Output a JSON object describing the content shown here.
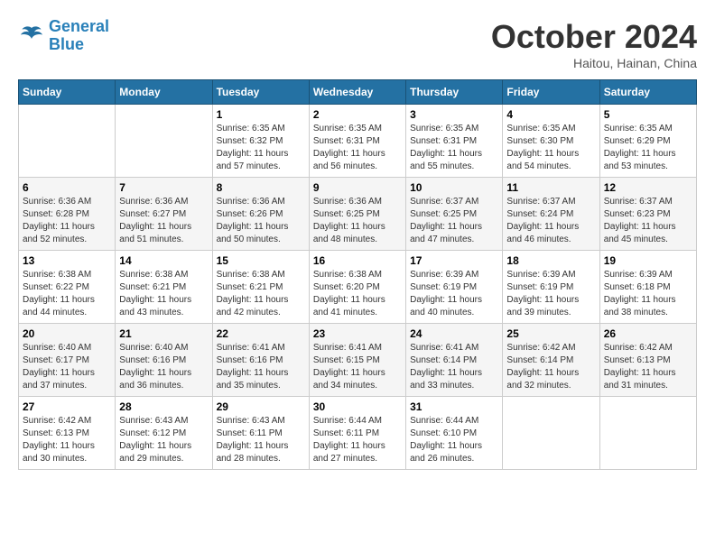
{
  "header": {
    "logo_line1": "General",
    "logo_line2": "Blue",
    "month_title": "October 2024",
    "location": "Haitou, Hainan, China"
  },
  "weekdays": [
    "Sunday",
    "Monday",
    "Tuesday",
    "Wednesday",
    "Thursday",
    "Friday",
    "Saturday"
  ],
  "weeks": [
    [
      {
        "day": "",
        "info": ""
      },
      {
        "day": "",
        "info": ""
      },
      {
        "day": "1",
        "info": "Sunrise: 6:35 AM\nSunset: 6:32 PM\nDaylight: 11 hours and 57 minutes."
      },
      {
        "day": "2",
        "info": "Sunrise: 6:35 AM\nSunset: 6:31 PM\nDaylight: 11 hours and 56 minutes."
      },
      {
        "day": "3",
        "info": "Sunrise: 6:35 AM\nSunset: 6:31 PM\nDaylight: 11 hours and 55 minutes."
      },
      {
        "day": "4",
        "info": "Sunrise: 6:35 AM\nSunset: 6:30 PM\nDaylight: 11 hours and 54 minutes."
      },
      {
        "day": "5",
        "info": "Sunrise: 6:35 AM\nSunset: 6:29 PM\nDaylight: 11 hours and 53 minutes."
      }
    ],
    [
      {
        "day": "6",
        "info": "Sunrise: 6:36 AM\nSunset: 6:28 PM\nDaylight: 11 hours and 52 minutes."
      },
      {
        "day": "7",
        "info": "Sunrise: 6:36 AM\nSunset: 6:27 PM\nDaylight: 11 hours and 51 minutes."
      },
      {
        "day": "8",
        "info": "Sunrise: 6:36 AM\nSunset: 6:26 PM\nDaylight: 11 hours and 50 minutes."
      },
      {
        "day": "9",
        "info": "Sunrise: 6:36 AM\nSunset: 6:25 PM\nDaylight: 11 hours and 48 minutes."
      },
      {
        "day": "10",
        "info": "Sunrise: 6:37 AM\nSunset: 6:25 PM\nDaylight: 11 hours and 47 minutes."
      },
      {
        "day": "11",
        "info": "Sunrise: 6:37 AM\nSunset: 6:24 PM\nDaylight: 11 hours and 46 minutes."
      },
      {
        "day": "12",
        "info": "Sunrise: 6:37 AM\nSunset: 6:23 PM\nDaylight: 11 hours and 45 minutes."
      }
    ],
    [
      {
        "day": "13",
        "info": "Sunrise: 6:38 AM\nSunset: 6:22 PM\nDaylight: 11 hours and 44 minutes."
      },
      {
        "day": "14",
        "info": "Sunrise: 6:38 AM\nSunset: 6:21 PM\nDaylight: 11 hours and 43 minutes."
      },
      {
        "day": "15",
        "info": "Sunrise: 6:38 AM\nSunset: 6:21 PM\nDaylight: 11 hours and 42 minutes."
      },
      {
        "day": "16",
        "info": "Sunrise: 6:38 AM\nSunset: 6:20 PM\nDaylight: 11 hours and 41 minutes."
      },
      {
        "day": "17",
        "info": "Sunrise: 6:39 AM\nSunset: 6:19 PM\nDaylight: 11 hours and 40 minutes."
      },
      {
        "day": "18",
        "info": "Sunrise: 6:39 AM\nSunset: 6:19 PM\nDaylight: 11 hours and 39 minutes."
      },
      {
        "day": "19",
        "info": "Sunrise: 6:39 AM\nSunset: 6:18 PM\nDaylight: 11 hours and 38 minutes."
      }
    ],
    [
      {
        "day": "20",
        "info": "Sunrise: 6:40 AM\nSunset: 6:17 PM\nDaylight: 11 hours and 37 minutes."
      },
      {
        "day": "21",
        "info": "Sunrise: 6:40 AM\nSunset: 6:16 PM\nDaylight: 11 hours and 36 minutes."
      },
      {
        "day": "22",
        "info": "Sunrise: 6:41 AM\nSunset: 6:16 PM\nDaylight: 11 hours and 35 minutes."
      },
      {
        "day": "23",
        "info": "Sunrise: 6:41 AM\nSunset: 6:15 PM\nDaylight: 11 hours and 34 minutes."
      },
      {
        "day": "24",
        "info": "Sunrise: 6:41 AM\nSunset: 6:14 PM\nDaylight: 11 hours and 33 minutes."
      },
      {
        "day": "25",
        "info": "Sunrise: 6:42 AM\nSunset: 6:14 PM\nDaylight: 11 hours and 32 minutes."
      },
      {
        "day": "26",
        "info": "Sunrise: 6:42 AM\nSunset: 6:13 PM\nDaylight: 11 hours and 31 minutes."
      }
    ],
    [
      {
        "day": "27",
        "info": "Sunrise: 6:42 AM\nSunset: 6:13 PM\nDaylight: 11 hours and 30 minutes."
      },
      {
        "day": "28",
        "info": "Sunrise: 6:43 AM\nSunset: 6:12 PM\nDaylight: 11 hours and 29 minutes."
      },
      {
        "day": "29",
        "info": "Sunrise: 6:43 AM\nSunset: 6:11 PM\nDaylight: 11 hours and 28 minutes."
      },
      {
        "day": "30",
        "info": "Sunrise: 6:44 AM\nSunset: 6:11 PM\nDaylight: 11 hours and 27 minutes."
      },
      {
        "day": "31",
        "info": "Sunrise: 6:44 AM\nSunset: 6:10 PM\nDaylight: 11 hours and 26 minutes."
      },
      {
        "day": "",
        "info": ""
      },
      {
        "day": "",
        "info": ""
      }
    ]
  ]
}
